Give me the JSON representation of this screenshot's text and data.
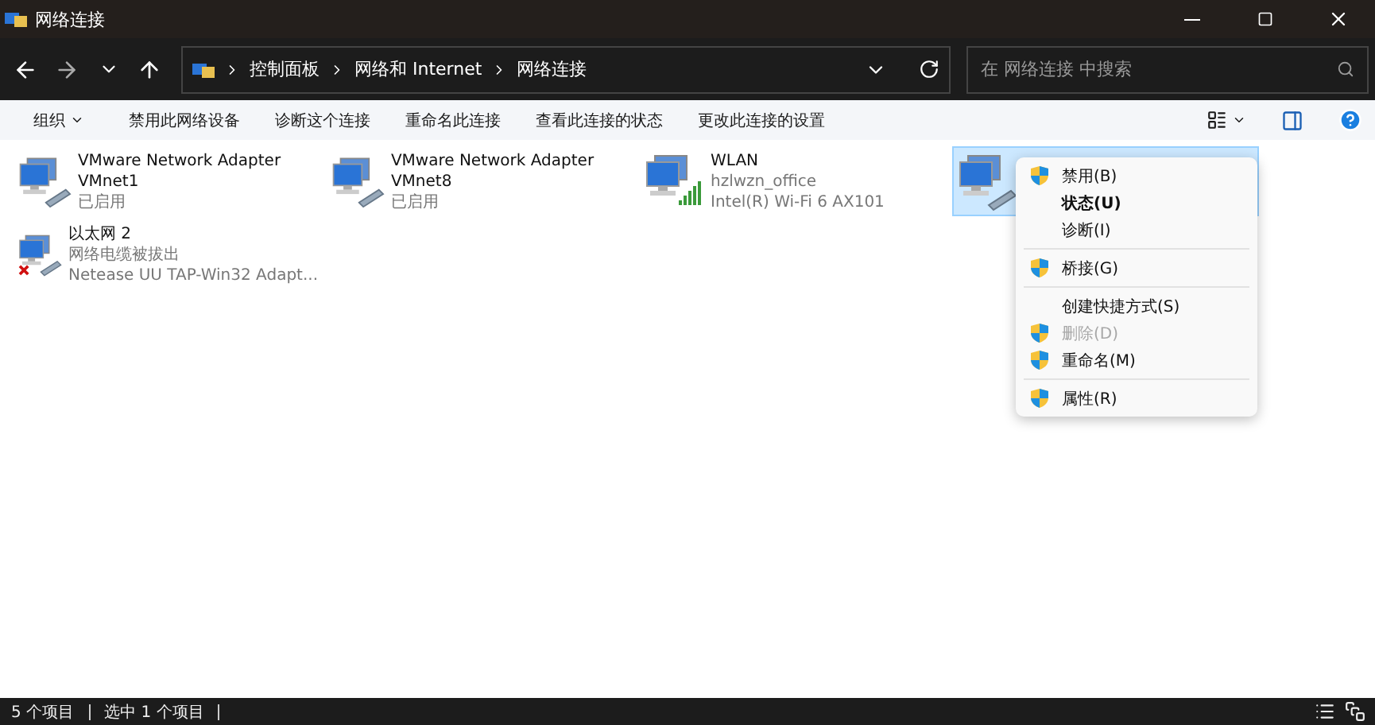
{
  "window": {
    "title": "网络连接"
  },
  "address": {
    "crumbs": [
      "控制面板",
      "网络和 Internet",
      "网络连接"
    ],
    "search_placeholder": "在 网络连接 中搜索"
  },
  "toolbar": {
    "organize": "组织",
    "commands": [
      "禁用此网络设备",
      "诊断这个连接",
      "重命名此连接",
      "查看此连接的状态",
      "更改此连接的设置"
    ]
  },
  "connections": [
    {
      "name": "VMware Network Adapter VMnet1",
      "line2": "已启用",
      "kind": "wired",
      "selected": false
    },
    {
      "name": "VMware Network Adapter VMnet8",
      "line2": "已启用",
      "kind": "wired",
      "selected": false
    },
    {
      "name": "WLAN",
      "line2": "hzlwzn_office",
      "line3": "Intel(R) Wi-Fi 6 AX101",
      "kind": "wifi",
      "selected": false
    },
    {
      "kind": "wired",
      "selected": true
    },
    {
      "name": "以太网 2",
      "line2": "网络电缆被拔出",
      "line3": "Netease UU TAP-Win32 Adapt...",
      "kind": "unplugged",
      "selected": false
    }
  ],
  "context_menu": {
    "groups": [
      [
        {
          "label": "禁用(B)",
          "shield": true,
          "bold": false,
          "disabled": false
        },
        {
          "label": "状态(U)",
          "shield": false,
          "bold": true,
          "disabled": false
        },
        {
          "label": "诊断(I)",
          "shield": false,
          "bold": false,
          "disabled": false
        }
      ],
      [
        {
          "label": "桥接(G)",
          "shield": true,
          "bold": false,
          "disabled": false
        }
      ],
      [
        {
          "label": "创建快捷方式(S)",
          "shield": false,
          "bold": false,
          "disabled": false
        },
        {
          "label": "删除(D)",
          "shield": true,
          "bold": false,
          "disabled": true
        },
        {
          "label": "重命名(M)",
          "shield": true,
          "bold": false,
          "disabled": false
        }
      ],
      [
        {
          "label": "属性(R)",
          "shield": true,
          "bold": false,
          "disabled": false
        }
      ]
    ]
  },
  "status_bar": {
    "count": "5 个项目",
    "selection": "选中 1 个项目"
  }
}
